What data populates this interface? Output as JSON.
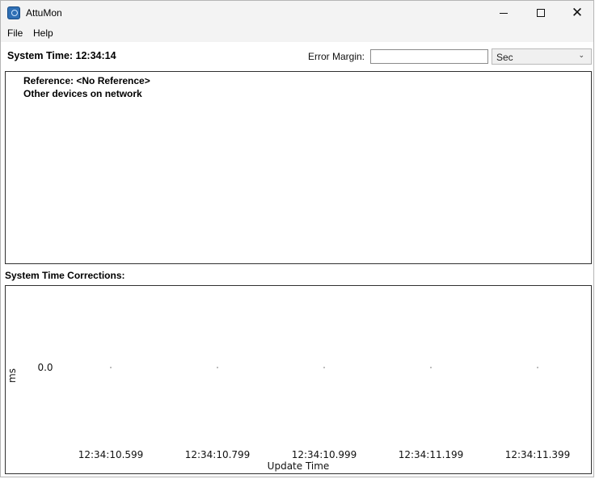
{
  "window": {
    "title": "AttuMon",
    "minimize_icon": "minimize-icon",
    "maximize_icon": "maximize-icon",
    "close_icon": "close-icon",
    "close_glyph": "✕"
  },
  "menu": {
    "items": [
      "File",
      "Help"
    ]
  },
  "status": {
    "system_time": "System Time: 12:34:14"
  },
  "error_margin": {
    "label": "Error Margin:",
    "value": "",
    "unit": "Sec",
    "unit_chevron": "⌄"
  },
  "devices": {
    "reference": "Reference: <No Reference>",
    "other_devices": "Other devices on network"
  },
  "corrections": {
    "label": "System Time Corrections:"
  },
  "chart_data": {
    "type": "scatter",
    "xlabel": "Update Time",
    "ylabel": "ms",
    "x_ticks": [
      "12:34:10.599",
      "12:34:10.799",
      "12:34:10.999",
      "12:34:11.199",
      "12:34:11.399"
    ],
    "y_ticks": [
      "0.0"
    ],
    "series": [
      {
        "x": [
          "12:34:10.599",
          "12:34:10.799",
          "12:34:10.999",
          "12:34:11.199",
          "12:34:11.399"
        ],
        "y": [
          0.0,
          0.0,
          0.0,
          0.0,
          0.0
        ]
      }
    ],
    "color": "#909090",
    "grid": false
  }
}
